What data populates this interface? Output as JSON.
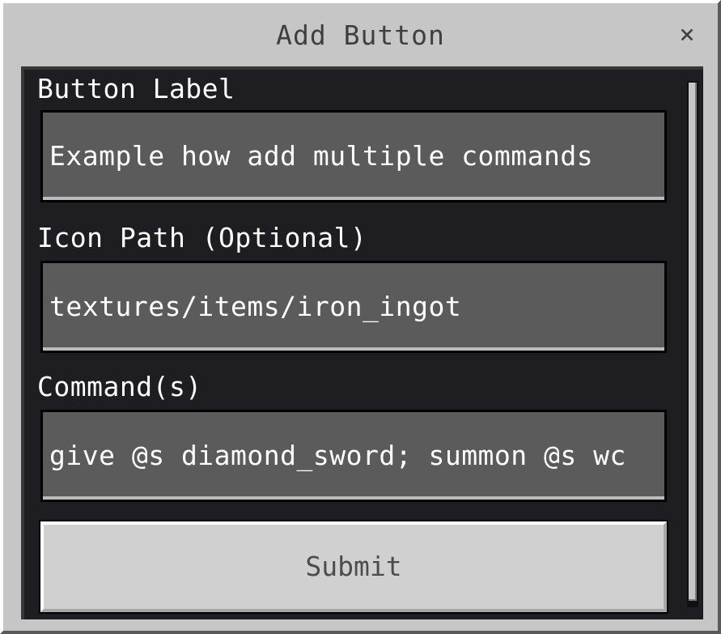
{
  "dialog": {
    "title": "Add Button",
    "close_glyph": "×"
  },
  "form": {
    "fields": [
      {
        "label": "Button Label",
        "value": "Example how add multiple commands"
      },
      {
        "label": "Icon Path (Optional)",
        "value": "textures/items/iron_ingot"
      },
      {
        "label": "Command(s)",
        "value": "give @s diamond_sword; summon @s wc"
      }
    ],
    "submit_label": "Submit"
  },
  "icons": {
    "close": "close-icon"
  },
  "colors": {
    "dialog_bg": "#c6c6c6",
    "content_bg": "#1e1e22",
    "field_bg": "#5b5b5b",
    "text_light": "#ffffff",
    "text_dark": "#3f3f3f"
  }
}
